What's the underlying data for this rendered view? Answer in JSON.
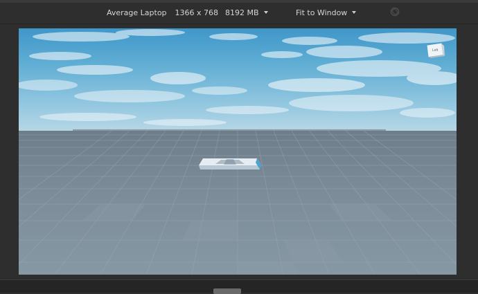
{
  "toolbar": {
    "device_name": "Average Laptop",
    "resolution": "1366 x 768",
    "memory": "8192 MB",
    "fit_mode": "Fit to Window",
    "device_dropdown_icon": "caret-down-icon",
    "fit_dropdown_icon": "caret-down-icon",
    "orientation_icon": "rotate-orientation-icon"
  },
  "viewport": {
    "description_colors": {
      "sky": "#5aa9d2",
      "ground": "#7b8c98",
      "part": "#dfe7ee"
    },
    "view_cube_label": "Left"
  }
}
